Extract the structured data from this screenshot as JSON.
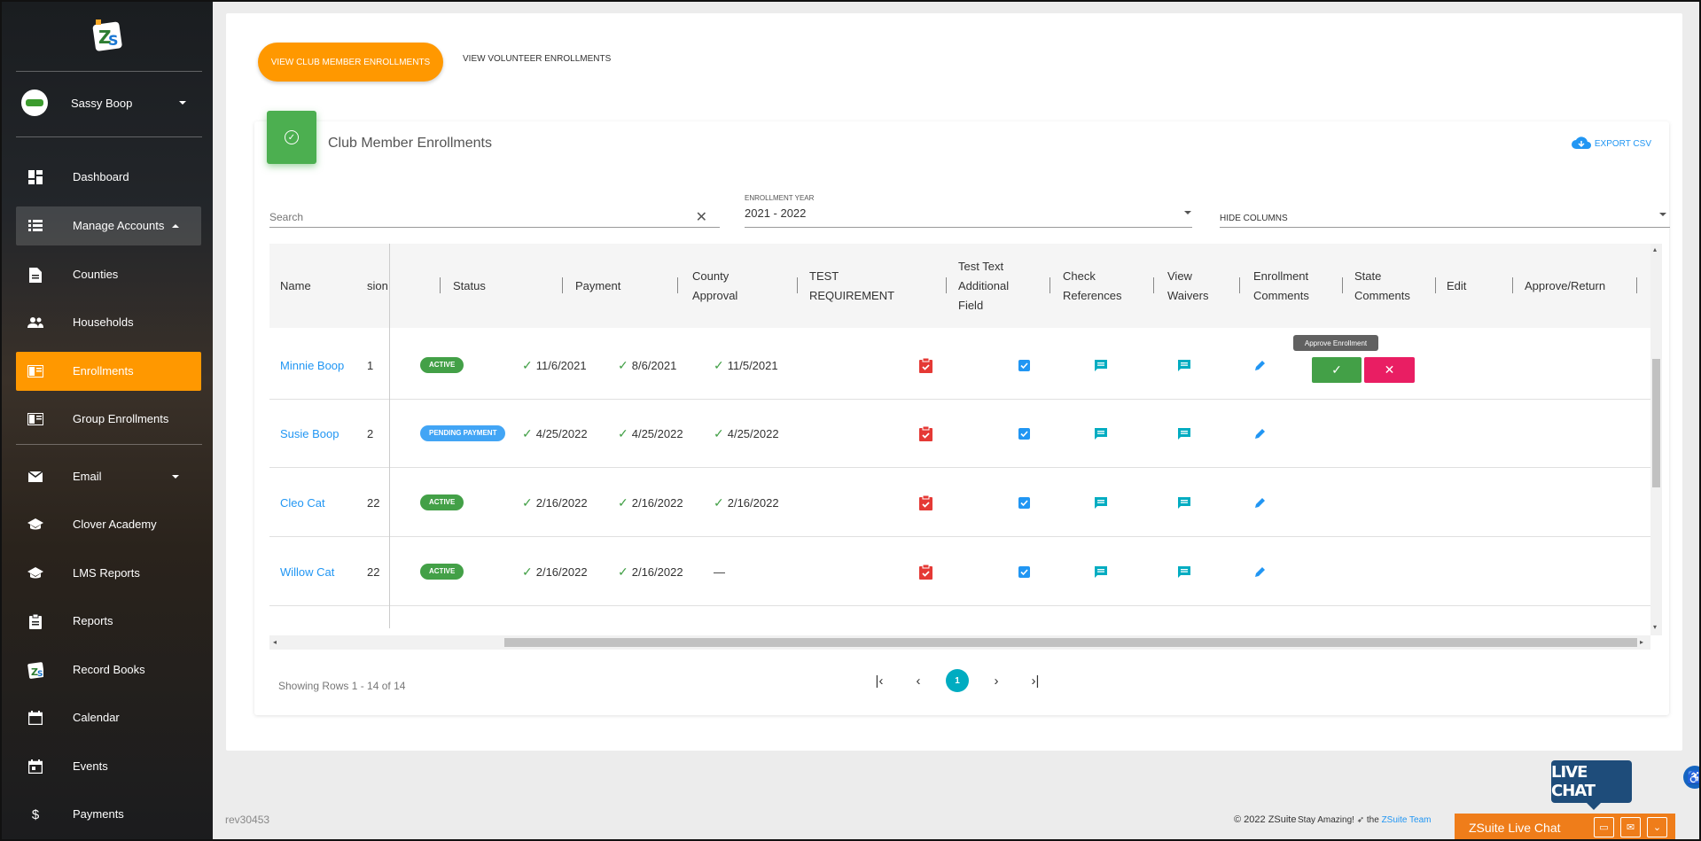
{
  "sidebar": {
    "user_name": "Sassy Boop",
    "items": [
      {
        "label": "Dashboard",
        "icon": "dashboard-icon"
      },
      {
        "label": "Manage Accounts",
        "icon": "list-icon"
      },
      {
        "label": "Counties",
        "icon": "document-icon"
      },
      {
        "label": "Households",
        "icon": "people-icon"
      },
      {
        "label": "Enrollments",
        "icon": "enrollment-icon"
      },
      {
        "label": "Group Enrollments",
        "icon": "enrollment-icon"
      },
      {
        "label": "Email",
        "icon": "mail-icon"
      },
      {
        "label": "Clover Academy",
        "icon": "school-icon"
      },
      {
        "label": "LMS Reports",
        "icon": "school-icon"
      },
      {
        "label": "Reports",
        "icon": "clipboard-icon"
      },
      {
        "label": "Record Books",
        "icon": "record-book-icon"
      },
      {
        "label": "Calendar",
        "icon": "calendar-icon"
      },
      {
        "label": "Events",
        "icon": "event-icon"
      },
      {
        "label": "Payments",
        "icon": "dollar-icon"
      }
    ]
  },
  "tabs": {
    "club_members": "VIEW CLUB MEMBER ENROLLMENTS",
    "volunteers": "VIEW VOLUNTEER ENROLLMENTS"
  },
  "card": {
    "title": "Club Member Enrollments",
    "export_label": "EXPORT CSV"
  },
  "filters": {
    "search_placeholder": "Search",
    "year_label": "ENROLLMENT YEAR",
    "year_value": "2021 - 2022",
    "hide_columns": "HIDE COLUMNS"
  },
  "table": {
    "headers": {
      "name": "Name",
      "session": "sion",
      "status": "Status",
      "payment": "Payment",
      "county_approval_1": "County",
      "county_approval_2": "Approval",
      "test_req_1": "TEST",
      "test_req_2": "REQUIREMENT",
      "test_text_1": "Test Text",
      "test_text_2": "Additional",
      "test_text_3": "Field",
      "check_refs_1": "Check",
      "check_refs_2": "References",
      "view_waivers_1": "View",
      "view_waivers_2": "Waivers",
      "enroll_comments_1": "Enrollment",
      "enroll_comments_2": "Comments",
      "state_comments_1": "State",
      "state_comments_2": "Comments",
      "edit": "Edit",
      "approve_return": "Approve/Return"
    },
    "rows": [
      {
        "name": "Minnie Boop",
        "session": "1",
        "status": "ACTIVE",
        "payment": "11/6/2021",
        "county": "8/6/2021",
        "test": "11/5/2021"
      },
      {
        "name": "Susie Boop",
        "session": "2",
        "status": "PENDING PAYMENT",
        "payment": "4/25/2022",
        "county": "4/25/2022",
        "test": "4/25/2022"
      },
      {
        "name": "Cleo Cat",
        "session": "22",
        "status": "ACTIVE",
        "payment": "2/16/2022",
        "county": "2/16/2022",
        "test": "2/16/2022"
      },
      {
        "name": "Willow Cat",
        "session": "22",
        "status": "ACTIVE",
        "payment": "2/16/2022",
        "county": "2/16/2022",
        "test": "—"
      }
    ],
    "tooltip": "Approve Enrollment"
  },
  "pagination": {
    "info": "Showing Rows 1 - 14 of 14",
    "current_page": "1"
  },
  "footer": {
    "revision": "rev30453",
    "copyright": "© 2022 ZSuite",
    "tagline": "Stay Amazing!",
    "tagline_the": "the",
    "tagline_link": "ZSuite Team"
  },
  "livechat": {
    "bubble": "LIVE CHAT",
    "bar_label": "ZSuite Live Chat"
  },
  "colors": {
    "orange": "#ff9800",
    "green": "#43a047",
    "blue": "#2196f3",
    "pink": "#e91e63"
  }
}
